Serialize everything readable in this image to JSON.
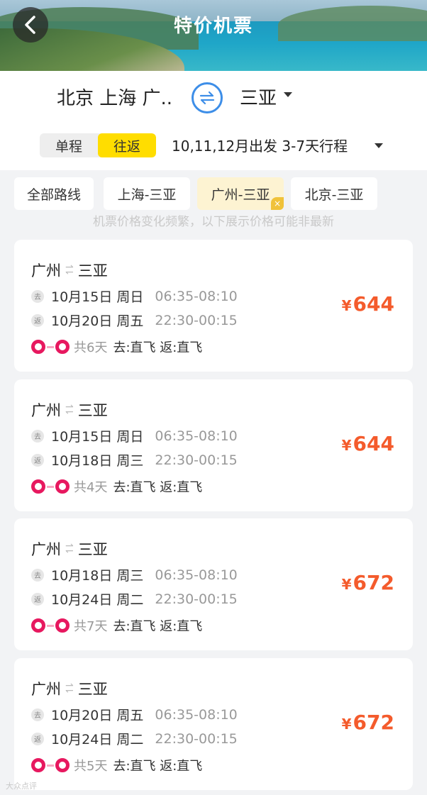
{
  "header": {
    "title": "特价机票"
  },
  "route": {
    "from": "北京 上海 广..",
    "to": "三亚"
  },
  "trip": {
    "options": [
      "单程",
      "往返"
    ],
    "active": 1,
    "desc": "10,11,12月出发 3-7天行程"
  },
  "chips": [
    "全部路线",
    "上海-三亚",
    "广州-三亚",
    "北京-三亚"
  ],
  "chip_close": "×",
  "notice": "机票价格变化频繁，以下展示价格可能非最新",
  "leg_tags": {
    "out": "去",
    "ret": "返"
  },
  "currency": "¥",
  "flights": [
    {
      "from": "广州",
      "to": "三亚",
      "out_date": "10月15日 周日",
      "out_time": "06:35-08:10",
      "ret_date": "10月20日 周五",
      "ret_time": "22:30-00:15",
      "days": "共6天",
      "flight": "去:直飞 返:直飞",
      "price": "644"
    },
    {
      "from": "广州",
      "to": "三亚",
      "out_date": "10月15日 周日",
      "out_time": "06:35-08:10",
      "ret_date": "10月18日 周三",
      "ret_time": "22:30-00:15",
      "days": "共4天",
      "flight": "去:直飞 返:直飞",
      "price": "644"
    },
    {
      "from": "广州",
      "to": "三亚",
      "out_date": "10月18日 周三",
      "out_time": "06:35-08:10",
      "ret_date": "10月24日 周二",
      "ret_time": "22:30-00:15",
      "days": "共7天",
      "flight": "去:直飞 返:直飞",
      "price": "672"
    },
    {
      "from": "广州",
      "to": "三亚",
      "out_date": "10月20日 周五",
      "out_time": "06:35-08:10",
      "ret_date": "10月24日 周二",
      "ret_time": "22:30-00:15",
      "days": "共5天",
      "flight": "去:直飞 返:直飞",
      "price": "672"
    }
  ],
  "watermark": "大众点评",
  "colors": {
    "accent": "#ffdd00",
    "price": "#f45b2c",
    "swap": "#3d8ee8",
    "logo": "#e7185f"
  }
}
